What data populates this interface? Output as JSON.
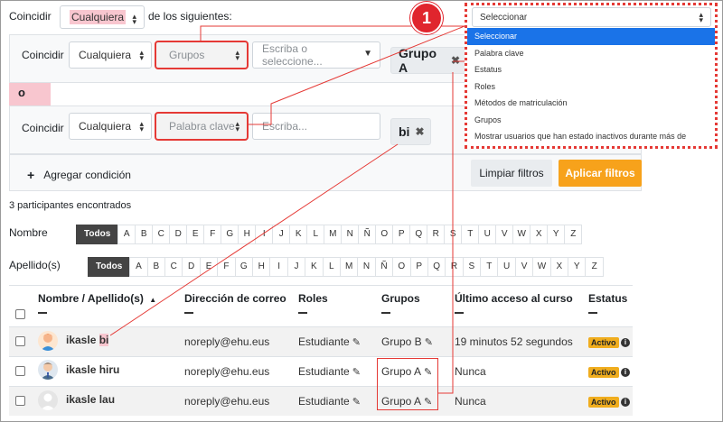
{
  "filters": {
    "match_label": "Coincidir",
    "match_value": "Cualquiera",
    "match_suffix": "de los siguientes:",
    "row1": {
      "match_label": "Coincidir",
      "match_value": "Cualquiera",
      "type_value": "Grupos",
      "input_placeholder": "Escriba o seleccione...",
      "tag": "Grupo A"
    },
    "or_label": "o",
    "row2": {
      "match_label": "Coincidir",
      "match_value": "Cualquiera",
      "type_value": "Palabra clave",
      "input_placeholder": "Escriba...",
      "tag": "bi"
    },
    "add_condition": "Agregar condición",
    "clear_button": "Limpiar filtros",
    "apply_button": "Aplicar filtros",
    "apply_color": "#f7a21b"
  },
  "dropdown": {
    "value": "Seleccionar",
    "options": [
      "Seleccionar",
      "Palabra clave",
      "Estatus",
      "Roles",
      "Métodos de matriculación",
      "Grupos",
      "Mostrar usuarios que han estado inactivos durante más de"
    ],
    "selected_index": 0
  },
  "callout_number": "1",
  "participants_found": "3 participantes encontrados",
  "initials": {
    "first_label": "Nombre",
    "last_label": "Apellido(s)",
    "all_label": "Todos",
    "letters": [
      "A",
      "B",
      "C",
      "D",
      "E",
      "F",
      "G",
      "H",
      "I",
      "J",
      "K",
      "L",
      "M",
      "N",
      "Ñ",
      "O",
      "P",
      "Q",
      "R",
      "S",
      "T",
      "U",
      "V",
      "W",
      "X",
      "Y",
      "Z"
    ]
  },
  "table": {
    "headers": [
      "Nombre / Apellido(s)",
      "Dirección de correo",
      "Roles",
      "Grupos",
      "Último acceso al curso",
      "Estatus"
    ],
    "sort_icon": "sort-asc-icon",
    "rows": [
      {
        "name_prefix": "ikasle ",
        "name_highlight": "bi",
        "email": "noreply@ehu.eus",
        "role": "Estudiante",
        "group": "Grupo B",
        "last_access": "19 minutos 52 segundos",
        "status": "Activo",
        "avatar": "avatar-orange"
      },
      {
        "name_prefix": "ikasle hiru",
        "name_highlight": "",
        "email": "noreply@ehu.eus",
        "role": "Estudiante",
        "group": "Grupo A",
        "last_access": "Nunca",
        "status": "Activo",
        "avatar": "avatar-man-tie"
      },
      {
        "name_prefix": "ikasle lau",
        "name_highlight": "",
        "email": "noreply@ehu.eus",
        "role": "Estudiante",
        "group": "Grupo A",
        "last_access": "Nunca",
        "status": "Activo",
        "avatar": "avatar-default"
      }
    ]
  },
  "colors": {
    "annotation_red": "#e53935",
    "highlight_pink": "#f8c6cf",
    "status_badge": "#f0ad1e",
    "dropdown_selected": "#1a73e8"
  }
}
